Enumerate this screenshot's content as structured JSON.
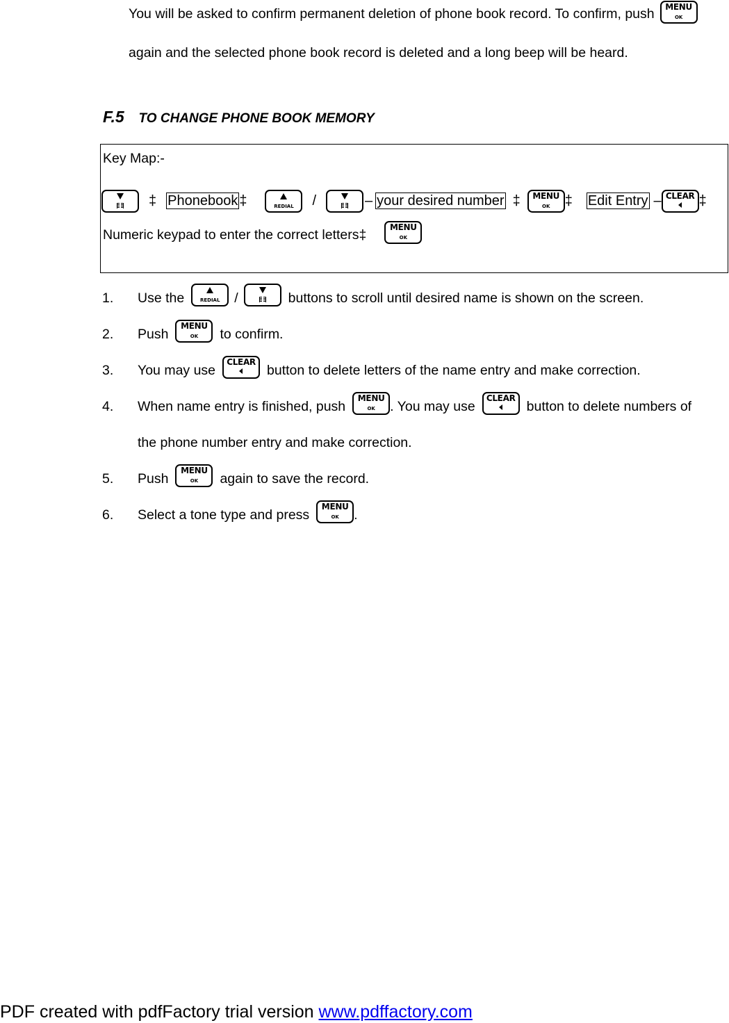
{
  "intro": {
    "line1": "You will be asked to confirm permanent deletion of phone book record. To confirm, push",
    "line2": "again and the selected phone book record is deleted and a long beep will be heard."
  },
  "section": {
    "number": "F.5",
    "title": "TO CHANGE PHONE BOOK MEMORY"
  },
  "keymap": {
    "label": "Key Map:-",
    "arrow": "‡",
    "slash": "/",
    "dash": "–",
    "phonebook": "Phonebook",
    "desired_number": "your desired number",
    "edit_entry": "Edit Entry",
    "numeric_text": "Numeric keypad to enter the correct letters‡"
  },
  "keys": {
    "menu_top": "MENU",
    "menu_bottom": "OK",
    "clear_top": "CLEAR",
    "redial_bottom": "REDIAL"
  },
  "steps": [
    {
      "num": "1.",
      "a": "Use the",
      "sep": "/",
      "b": "buttons to scroll until desired name is shown on the screen."
    },
    {
      "num": "2.",
      "a": "Push",
      "b": "to confirm."
    },
    {
      "num": "3.",
      "a": "You may use",
      "b": "button to delete letters of the name entry and make correction."
    },
    {
      "num": "4.",
      "a": "When name entry is finished, push",
      "b": ". You may use",
      "c": "button to delete numbers of",
      "d": "the phone number entry and make correction."
    },
    {
      "num": "5.",
      "a": "Push",
      "b": "again to save the record."
    },
    {
      "num": "6.",
      "a": "Select a tone type and press",
      "b": "."
    }
  ],
  "footer": {
    "text": "PDF created with pdfFactory trial version ",
    "link": "www.pdffactory.com"
  }
}
